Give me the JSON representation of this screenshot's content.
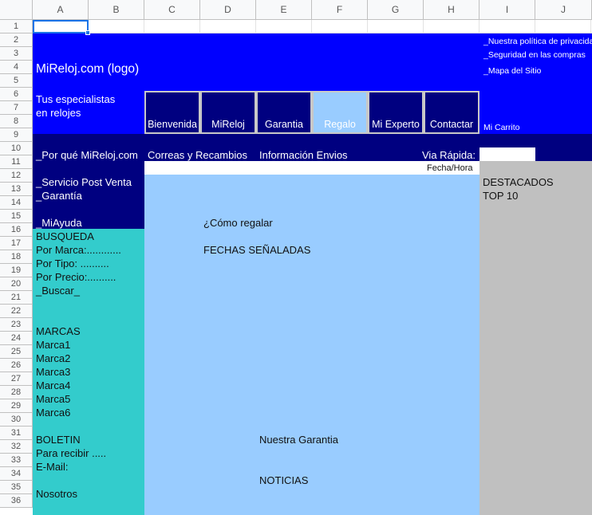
{
  "columns": [
    "A",
    "B",
    "C",
    "D",
    "E",
    "F",
    "G",
    "H",
    "I",
    "J"
  ],
  "rows": [
    "1",
    "2",
    "3",
    "4",
    "5",
    "6",
    "7",
    "8",
    "9",
    "10",
    "11",
    "12",
    "13",
    "14",
    "15",
    "16",
    "17",
    "18",
    "19",
    "20",
    "21",
    "22",
    "23",
    "24",
    "25",
    "26",
    "27",
    "28",
    "29",
    "30",
    "31",
    "32",
    "33",
    "34",
    "35",
    "36"
  ],
  "header": {
    "logo": "MiReloj.com (logo)",
    "tagline_1": "Tus especialistas",
    "tagline_2": "en relojes",
    "links": [
      "_Nuestra política de privacidad",
      "_Seguridad en las compras",
      "_Mapa del Sitio"
    ],
    "cart": "Mi Carrito"
  },
  "nav": {
    "items": [
      {
        "label": "Bienvenida"
      },
      {
        "label": "MiReloj"
      },
      {
        "label": "Garantia"
      },
      {
        "label": "Regalo"
      },
      {
        "label": "Mi Experto"
      },
      {
        "label": "Contactar"
      }
    ],
    "active": "Regalo"
  },
  "subnav": {
    "why": "_Por qué MiReloj.com",
    "straps": "Correas y Recambios",
    "shipping": "Información Envios",
    "quick": "Via Rápida:",
    "datetime": "Fecha/Hora"
  },
  "left": {
    "service": "_Servicio Post Venta",
    "warranty": "_Garantía",
    "help": "_MiAyuda",
    "search_title": "BUSQUEDA",
    "by_brand": "Por Marca:............",
    "by_type": "Por Tipo: ..........",
    "by_price": "Por Precio:..........",
    "search_btn": "_Buscar_",
    "brands_title": "MARCAS",
    "brands": [
      "Marca1",
      "Marca2",
      "Marca3",
      "Marca4",
      "Marca5",
      "Marca6"
    ],
    "newsletter_title": "BOLETIN",
    "receive": "Para recibir .....",
    "email": "E-Mail:",
    "about": "Nosotros"
  },
  "main": {
    "how_to_gift": "¿Cómo regalar",
    "dates": "FECHAS SEÑALADAS",
    "our_warranty": "Nuestra Garantia",
    "news": "NOTICIAS"
  },
  "right": {
    "featured": "DESTACADOS",
    "top10": "TOP 10"
  },
  "colors": {
    "header_blue": "#0000ff",
    "navy": "#000080",
    "teal": "#33cccc",
    "light_blue": "#99ccff",
    "gray": "#c0c0c0"
  }
}
